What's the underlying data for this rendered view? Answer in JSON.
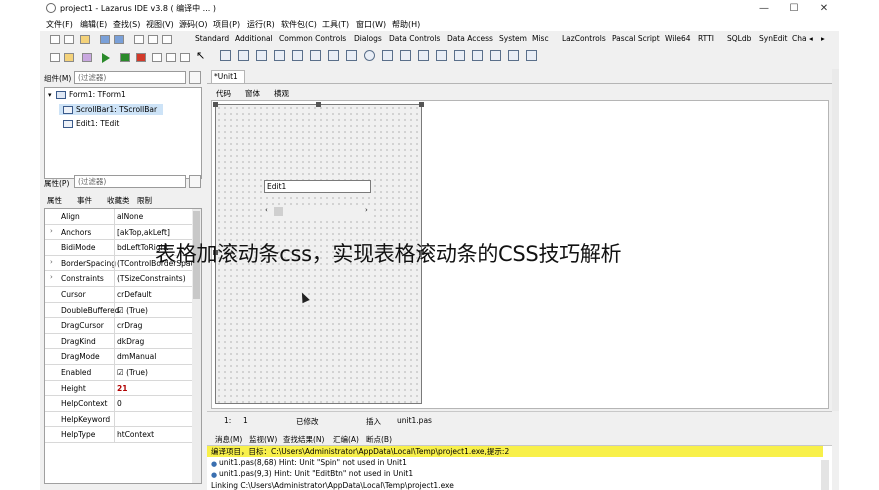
{
  "window": {
    "title": "project1 - Lazarus IDE v3.8 ( 编译中 ... )",
    "minimize": "—",
    "maximize": "☐",
    "close": "✕"
  },
  "menu": [
    "文件(F)",
    "编辑(E)",
    "查找(S)",
    "视图(V)",
    "源码(O)",
    "项目(P)",
    "运行(R)",
    "软件包(C)",
    "工具(T)",
    "窗口(W)",
    "帮助(H)"
  ],
  "palette_tabs": [
    "Standard",
    "Additional",
    "Common Controls",
    "Dialogs",
    "Data Controls",
    "Data Access",
    "System",
    "Misc",
    "LazControls",
    "Pascal Script",
    "Wile64",
    "RTTI",
    "SQLdb",
    "SynEdit",
    "Cha"
  ],
  "palette_nav": {
    "left": "◂",
    "right": "▸"
  },
  "components": {
    "label": "组件(M)",
    "filter_placeholder": "(过滤器)",
    "tree": [
      "Form1: TForm1",
      "ScrollBar1: TScrollBar",
      "Edit1: TEdit"
    ]
  },
  "properties": {
    "label": "属性(P)",
    "filter_placeholder": "(过滤器)",
    "tabs": [
      "属性",
      "事件",
      "收藏类",
      "限制"
    ],
    "rows": [
      {
        "name": "Align",
        "value": "alNone",
        "expand": ""
      },
      {
        "name": "Anchors",
        "value": "[akTop,akLeft]",
        "expand": "›"
      },
      {
        "name": "BidiMode",
        "value": "bdLeftToRight",
        "expand": ""
      },
      {
        "name": "BorderSpacing",
        "value": "(TControlBorderSpacing)",
        "expand": "›"
      },
      {
        "name": "Constraints",
        "value": "(TSizeConstraints)",
        "expand": "›"
      },
      {
        "name": "Cursor",
        "value": "crDefault",
        "expand": ""
      },
      {
        "name": "DoubleBuffered",
        "value": "☑ (True)",
        "expand": ""
      },
      {
        "name": "DragCursor",
        "value": "crDrag",
        "expand": ""
      },
      {
        "name": "DragKind",
        "value": "dkDrag",
        "expand": ""
      },
      {
        "name": "DragMode",
        "value": "dmManual",
        "expand": ""
      },
      {
        "name": "Enabled",
        "value": "☑ (True)",
        "expand": ""
      },
      {
        "name": "Height",
        "value": "21",
        "expand": ""
      },
      {
        "name": "HelpContext",
        "value": "0",
        "expand": ""
      },
      {
        "name": "HelpKeyword",
        "value": "",
        "expand": ""
      },
      {
        "name": "HelpType",
        "value": "htContext",
        "expand": ""
      }
    ]
  },
  "editor": {
    "tab": "*Unit1",
    "subtabs": [
      "代码",
      "窗体",
      "横观"
    ],
    "edit_text": "Edit1",
    "scroll_left": "‹",
    "scroll_right": "›"
  },
  "status": {
    "line": "1:",
    "col": "1",
    "modified": "已修改",
    "mode": "插入",
    "file": "unit1.pas"
  },
  "message_tabs": [
    "消息(M)",
    "监视(W)",
    "查找结果(N)",
    "汇编(A)",
    "断点(B)"
  ],
  "messages": [
    "编译项目，目标：C:\\Users\\Administrator\\AppData\\Local\\Temp\\project1.exe,提示:2",
    "unit1.pas(8,68) Hint: Unit \"Spin\" not used in Unit1",
    "unit1.pas(9,3) Hint: Unit \"EditBtn\" not used in Unit1",
    "Linking C:\\Users\\Administrator\\AppData\\Local\\Temp\\project1.exe"
  ],
  "overlay_caption": "表格加滚动条css，实现表格滚动条的CSS技巧解析",
  "colors": {
    "highlight": "#f8f04a",
    "bold_value": "#b00000"
  }
}
